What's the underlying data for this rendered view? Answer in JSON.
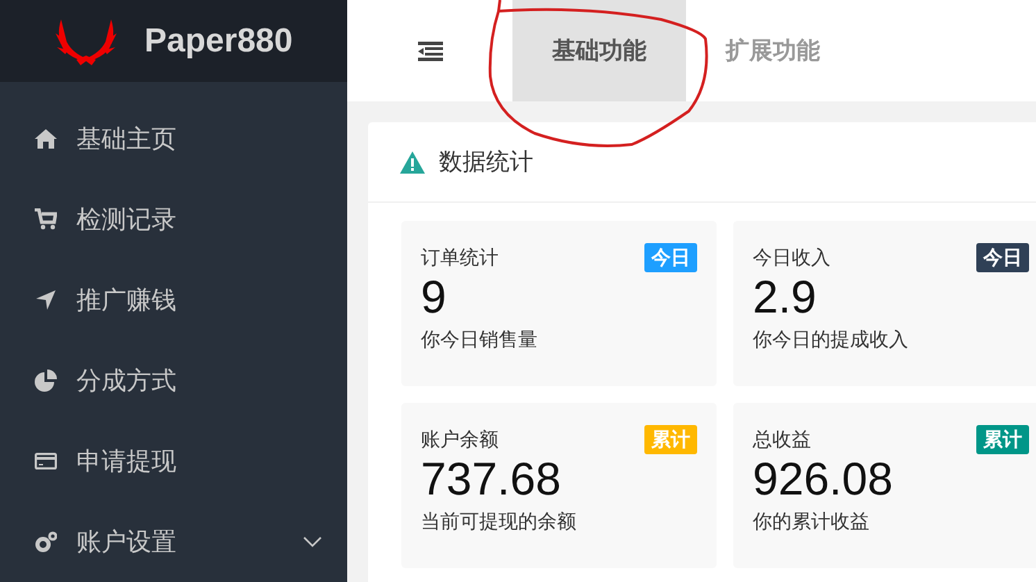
{
  "brand": {
    "name": "Paper880"
  },
  "sidebar": {
    "items": [
      {
        "label": "基础主页",
        "expandable": false
      },
      {
        "label": "检测记录",
        "expandable": false
      },
      {
        "label": "推广赚钱",
        "expandable": false
      },
      {
        "label": "分成方式",
        "expandable": false
      },
      {
        "label": "申请提现",
        "expandable": false
      },
      {
        "label": "账户设置",
        "expandable": true
      }
    ]
  },
  "tabs": [
    {
      "label": "基础功能",
      "selected": true
    },
    {
      "label": "扩展功能",
      "selected": false
    }
  ],
  "panel": {
    "title": "数据统计",
    "stats": [
      {
        "title": "订单统计",
        "badge": "今日",
        "color": "#1e9fff",
        "value": "9",
        "caption": "你今日销售量"
      },
      {
        "title": "今日收入",
        "badge": "今日",
        "color": "#2f4056",
        "value": "2.9",
        "caption": "你今日的提成收入"
      },
      {
        "title": "账户余额",
        "badge": "累计",
        "color": "#ffb800",
        "value": "737.68",
        "caption": "当前可提现的余额"
      },
      {
        "title": "总收益",
        "badge": "累计",
        "color": "#009688",
        "value": "926.08",
        "caption": "你的累计收益"
      }
    ]
  }
}
